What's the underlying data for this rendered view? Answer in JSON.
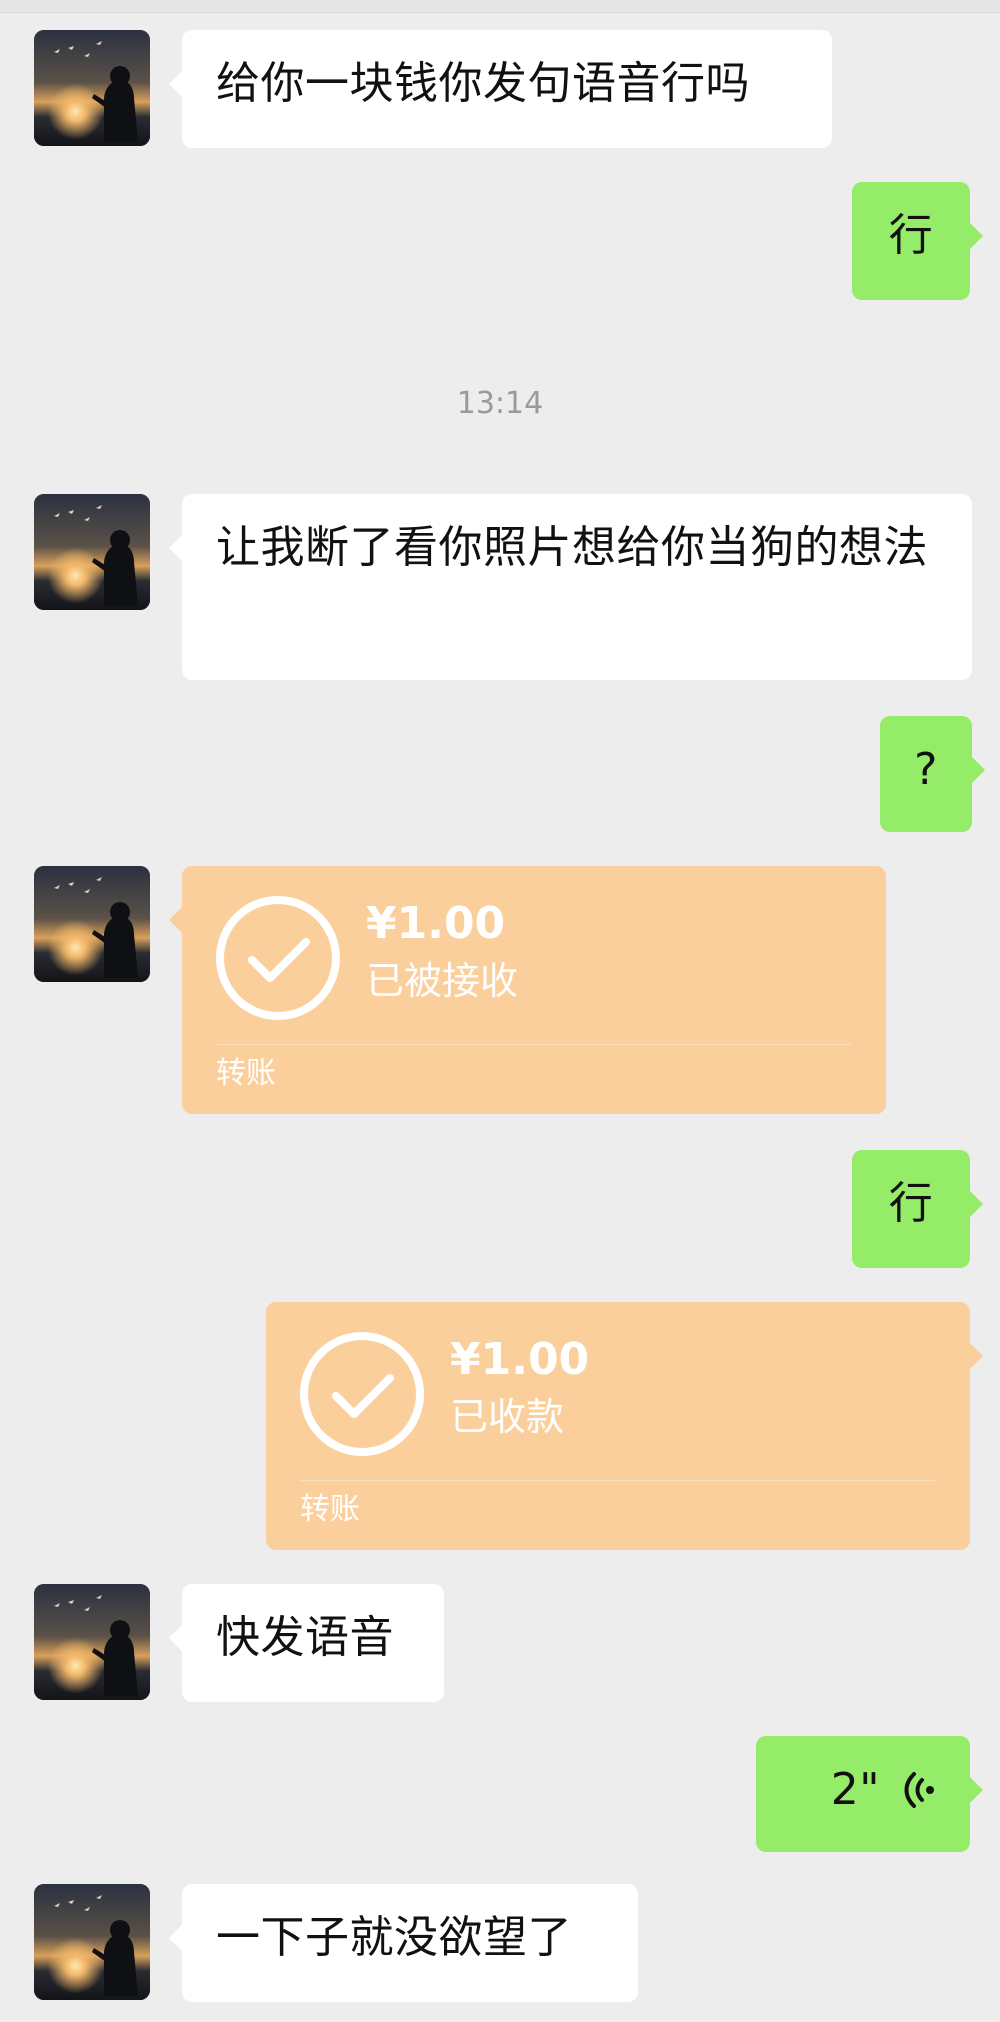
{
  "messages": {
    "m1": {
      "text": "给你一块钱你发句语音行吗"
    },
    "m2": {
      "text": "行"
    },
    "time": {
      "text": "13:14"
    },
    "m3": {
      "text": "让我断了看你照片想给你当狗的想法"
    },
    "m4": {
      "text": "?"
    },
    "transfer1": {
      "amount": "¥1.00",
      "status": "已被接收",
      "label": "转账"
    },
    "m5": {
      "text": "行"
    },
    "transfer2": {
      "amount": "¥1.00",
      "status": "已收款",
      "label": "转账"
    },
    "m6": {
      "text": "快发语音"
    },
    "voice": {
      "duration": "2\""
    },
    "m7": {
      "text": "一下子就没欲望了"
    }
  },
  "colors": {
    "background": "#ededed",
    "sent_bubble": "#95ec69",
    "received_bubble": "#ffffff",
    "transfer_card": "#fbcf9c",
    "timestamp_text": "#9a9a9a"
  },
  "icons": {
    "avatar": "avatar-sunset-silhouette",
    "transfer_check": "check-circle-icon",
    "voice": "voice-wave-icon"
  }
}
